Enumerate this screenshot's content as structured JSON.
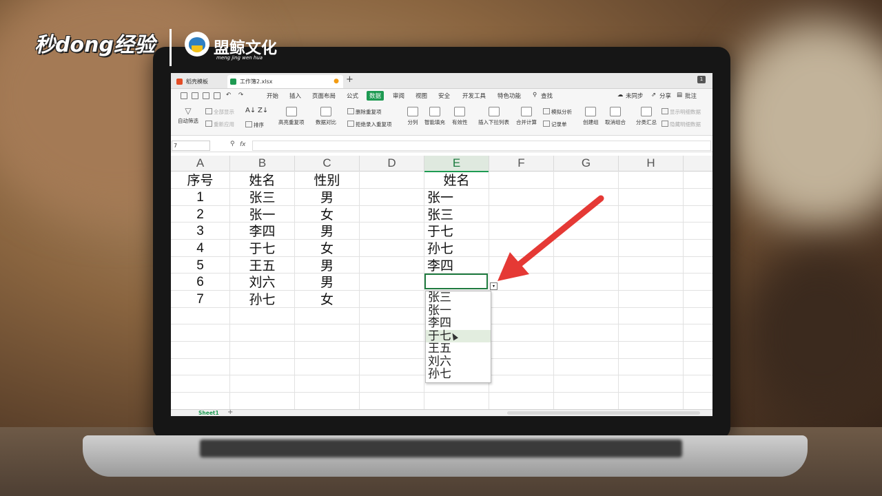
{
  "branding": {
    "left_logo": "秒dong经验",
    "right_logo": "盟鲸文化",
    "right_logo_pinyin": "meng jing wen hua"
  },
  "tabs": [
    {
      "label": "稻壳模板"
    },
    {
      "label": "工作簿2.xlsx"
    }
  ],
  "window_badge": "1",
  "menu": {
    "items": [
      "开始",
      "插入",
      "页面布局",
      "公式",
      "数据",
      "审阅",
      "视图",
      "安全",
      "开发工具",
      "特色功能"
    ],
    "active": "数据",
    "search": "查找",
    "right": [
      "未同步",
      "分享",
      "批注"
    ]
  },
  "ribbon": {
    "auto_filter": "自动筛选",
    "show_all": "全部显示",
    "reapply": "重新应用",
    "sort": "排序",
    "highlight_dup": "高亮重复项",
    "delete_dup": "删除重复项",
    "reject_dup": "拒绝录入重复项",
    "data_compare": "数据对比",
    "split": "分列",
    "smart_fill": "智能填充",
    "validity": "有效性",
    "insert_dropdown": "插入下拉列表",
    "consolidate": "合并计算",
    "simulation": "模拟分析",
    "record_form": "记录单",
    "create_group": "创建组",
    "ungroup": "取消组合",
    "subtotal": "分类汇总",
    "show_detail": "显示明细数据",
    "hide_detail": "隐藏明细数据"
  },
  "formula_bar": {
    "name_box": "7",
    "fx": "fx",
    "value": ""
  },
  "columns": [
    "A",
    "B",
    "C",
    "D",
    "E",
    "F",
    "G",
    "H"
  ],
  "selected_column": "E",
  "table": {
    "headers": {
      "a": "序号",
      "b": "姓名",
      "c": "性别",
      "e": "姓名"
    },
    "rows": [
      {
        "a": "1",
        "b": "张三",
        "c": "男",
        "e": "张一"
      },
      {
        "a": "2",
        "b": "张一",
        "c": "女",
        "e": "张三"
      },
      {
        "a": "3",
        "b": "李四",
        "c": "男",
        "e": "于七"
      },
      {
        "a": "4",
        "b": "于七",
        "c": "女",
        "e": "孙七"
      },
      {
        "a": "5",
        "b": "王五",
        "c": "男",
        "e": "李四"
      },
      {
        "a": "6",
        "b": "刘六",
        "c": "男",
        "e": ""
      },
      {
        "a": "7",
        "b": "孙七",
        "c": "女"
      }
    ]
  },
  "dropdown": {
    "options": [
      "张三",
      "张一",
      "李四",
      "于七",
      "王五",
      "刘六",
      "孙七"
    ],
    "highlighted": "于七"
  },
  "sheets": [
    "Sheet1"
  ],
  "colors": {
    "accent": "#1e9a52",
    "arrow": "#e53935"
  }
}
